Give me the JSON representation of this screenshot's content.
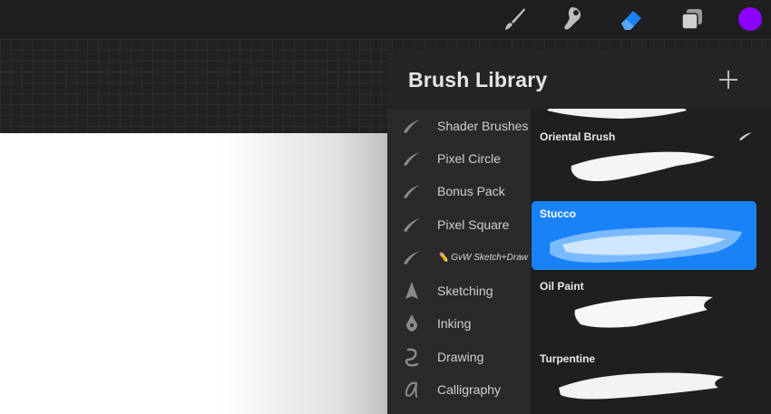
{
  "toolbar": {
    "tools": [
      {
        "name": "paintbrush-icon",
        "active": false
      },
      {
        "name": "smudge-icon",
        "active": false
      },
      {
        "name": "eraser-icon",
        "active": true
      },
      {
        "name": "layers-icon",
        "active": false
      }
    ],
    "color": "#8b00ff",
    "active_color_hex": "#1a82f7"
  },
  "brush_library": {
    "title": "Brush Library",
    "categories": [
      {
        "label": "Shader Brushes",
        "icon": "brush-stroke-icon"
      },
      {
        "label": "Pixel Circle",
        "icon": "brush-stroke-icon"
      },
      {
        "label": "Bonus Pack",
        "icon": "brush-stroke-icon"
      },
      {
        "label": "Pixel Square",
        "icon": "brush-stroke-icon"
      },
      {
        "label": "✏️ GvW Sketch+Draw",
        "icon": "brush-stroke-icon"
      },
      {
        "label": "Sketching",
        "icon": "pencil-tip-icon"
      },
      {
        "label": "Inking",
        "icon": "ink-pen-icon"
      },
      {
        "label": "Drawing",
        "icon": "squiggle-icon"
      },
      {
        "label": "Calligraphy",
        "icon": "calligraphy-a-icon"
      }
    ],
    "brushes": [
      {
        "name": "Oriental Brush",
        "selected": false
      },
      {
        "name": "Stucco",
        "selected": true
      },
      {
        "name": "Oil Paint",
        "selected": false
      },
      {
        "name": "Turpentine",
        "selected": false
      }
    ]
  }
}
